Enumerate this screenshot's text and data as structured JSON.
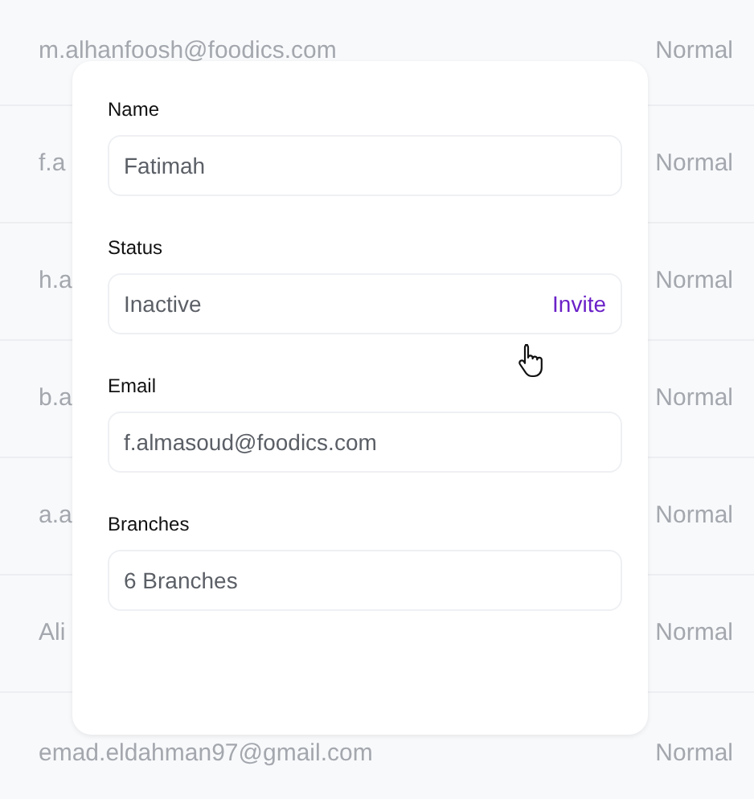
{
  "rows": [
    {
      "email": "m.alhanfoosh@foodics.com",
      "role": "Normal"
    },
    {
      "email": "f.a",
      "role": "Normal"
    },
    {
      "email": "h.a",
      "role": "Normal"
    },
    {
      "email": "b.a",
      "role": "Normal"
    },
    {
      "email": "a.a",
      "role": "Normal"
    },
    {
      "email": "Ali",
      "role": "Normal"
    },
    {
      "email": "emad.eldahman97@gmail.com",
      "role": "Normal"
    }
  ],
  "modal": {
    "fields": [
      {
        "label": "Name",
        "value": "Fatimah"
      },
      {
        "label": "Status",
        "value": "Inactive",
        "action": "Invite"
      },
      {
        "label": "Email",
        "value": "f.almasoud@foodics.com"
      },
      {
        "label": "Branches",
        "value": "6 Branches"
      }
    ]
  }
}
